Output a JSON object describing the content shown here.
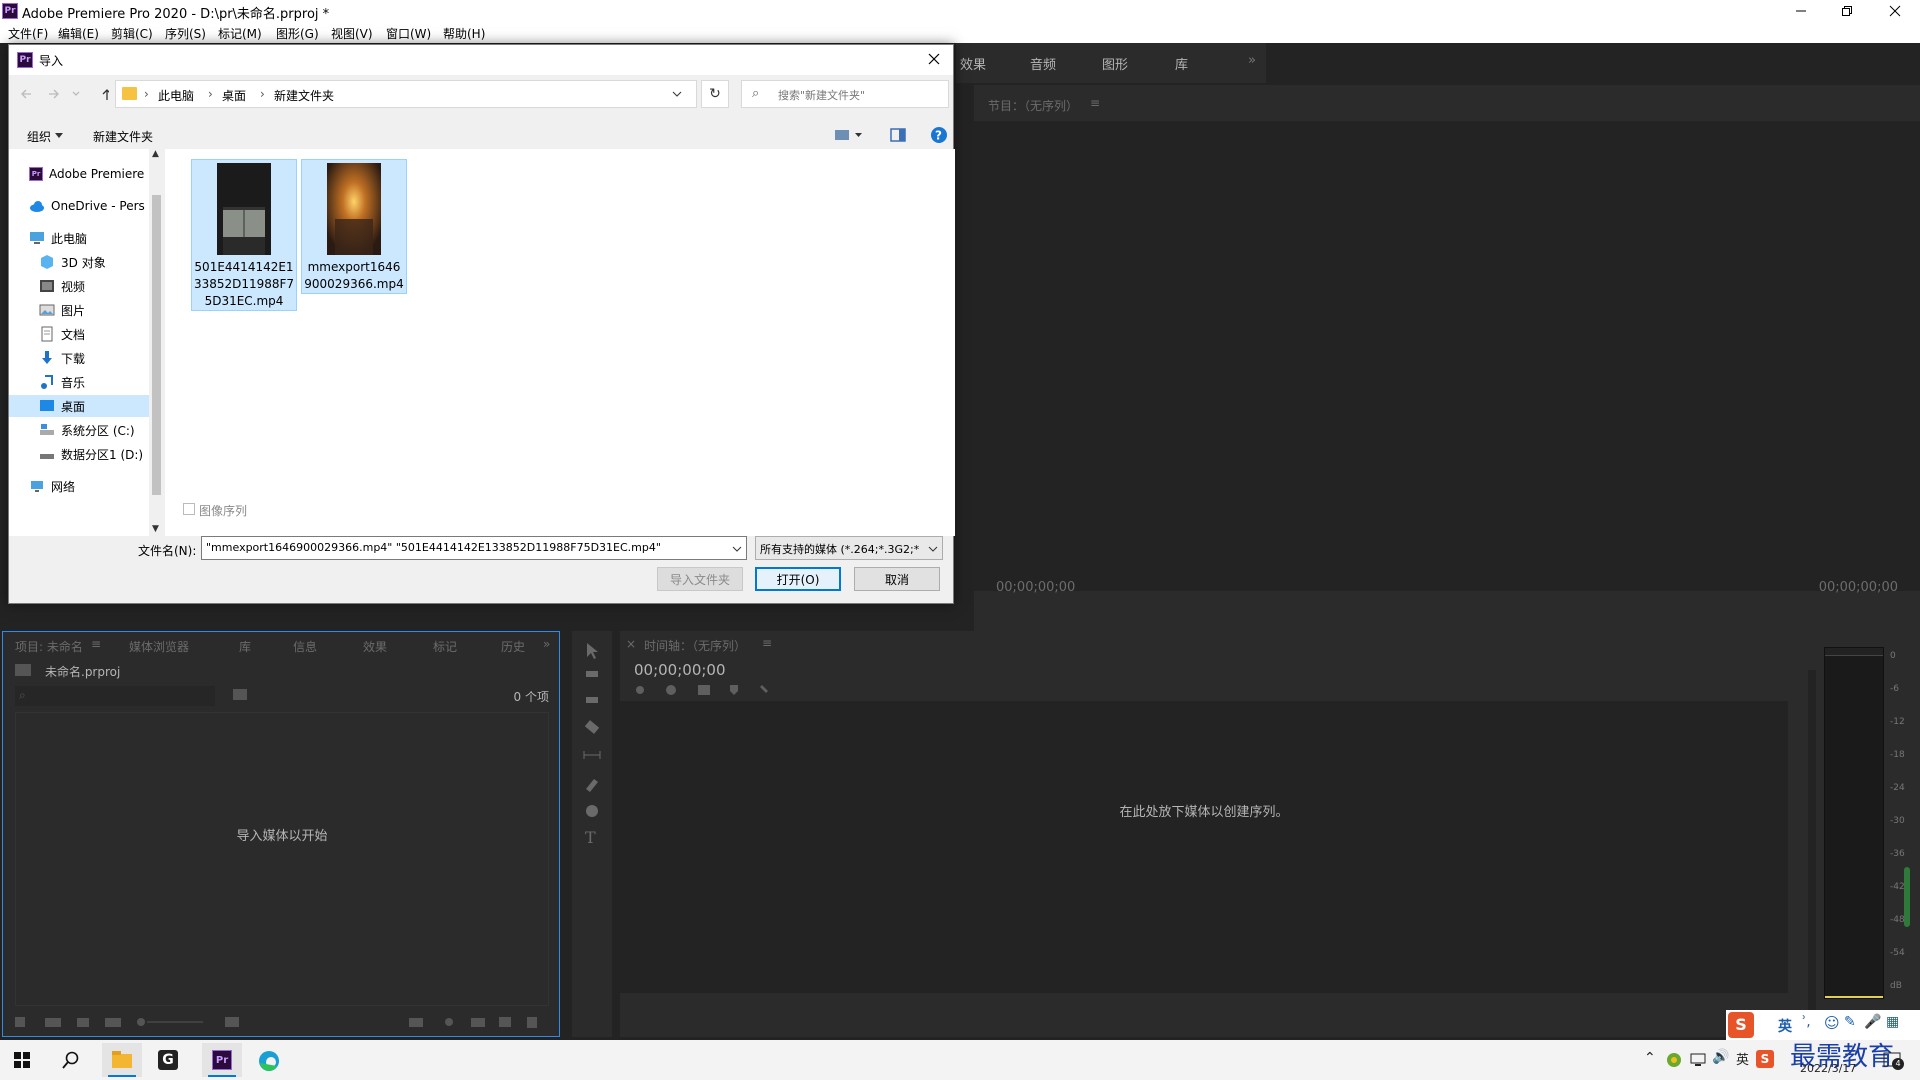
{
  "window": {
    "title": "Adobe Premiere Pro 2020 - D:\\pr\\未命名.prproj *",
    "logo_text": "Pr"
  },
  "menu": [
    "文件(F)",
    "编辑(E)",
    "剪辑(C)",
    "序列(S)",
    "标记(M)",
    "图形(G)",
    "视图(V)",
    "窗口(W)",
    "帮助(H)"
  ],
  "top_tabs": [
    "效果",
    "音频",
    "图形",
    "库"
  ],
  "program_monitor": {
    "title": "节目：（无序列）",
    "timecode_left": "00;00;00;00",
    "timecode_right": "00;00;00;00"
  },
  "project_panel": {
    "tabs": [
      "项目: 未命名",
      "媒体浏览器",
      "库",
      "信息",
      "效果",
      "标记",
      "历史"
    ],
    "file_name": "未命名.prproj",
    "item_count": "0 个项",
    "empty_text": "导入媒体以开始"
  },
  "timeline": {
    "title": "时间轴：（无序列）",
    "timecode": "00;00;00;00",
    "empty_text": "在此处放下媒体以创建序列。"
  },
  "audio_meter": {
    "scale": [
      "0",
      "-6",
      "-12",
      "-18",
      "-24",
      "-30",
      "-36",
      "-42",
      "-48",
      "-54",
      "dB"
    ]
  },
  "dialog": {
    "title": "导入",
    "path": [
      "此电脑",
      "桌面",
      "新建文件夹"
    ],
    "search_placeholder": "搜索\"新建文件夹\"",
    "organize": "组织",
    "new_folder": "新建文件夹",
    "nav": [
      {
        "label": "Adobe Premiere",
        "icon": "premiere-icon"
      },
      {
        "label": "OneDrive - Pers",
        "icon": "onedrive-icon"
      },
      {
        "label": "此电脑",
        "icon": "computer-icon"
      },
      {
        "label": "3D 对象",
        "icon": "cube-icon"
      },
      {
        "label": "视频",
        "icon": "video-icon"
      },
      {
        "label": "图片",
        "icon": "picture-icon"
      },
      {
        "label": "文档",
        "icon": "document-icon"
      },
      {
        "label": "下载",
        "icon": "download-icon"
      },
      {
        "label": "音乐",
        "icon": "music-icon"
      },
      {
        "label": "桌面",
        "icon": "desktop-icon"
      },
      {
        "label": "系统分区 (C:)",
        "icon": "drive-c-icon"
      },
      {
        "label": "数据分区1 (D:)",
        "icon": "drive-d-icon"
      },
      {
        "label": "网络",
        "icon": "network-icon"
      }
    ],
    "files": [
      {
        "name_lines": [
          "501E4414142E1",
          "33852D11988F7",
          "5D31EC.mp4"
        ]
      },
      {
        "name_lines": [
          "mmexport1646",
          "900029366.mp4"
        ]
      }
    ],
    "image_sequence": "图像序列",
    "filename_label": "文件名(N):",
    "filename_value": "\"mmexport1646900029366.mp4\" \"501E4414142E133852D11988F75D31EC.mp4\"",
    "filetype_value": "所有支持的媒体 (*.264;*.3G2;*",
    "import_folder": "导入文件夹",
    "open": "打开(O)",
    "cancel": "取消"
  },
  "taskbar": {
    "date": "2022/3/17",
    "ime": "英",
    "watermark": "最需教育",
    "notify_count": "4"
  }
}
